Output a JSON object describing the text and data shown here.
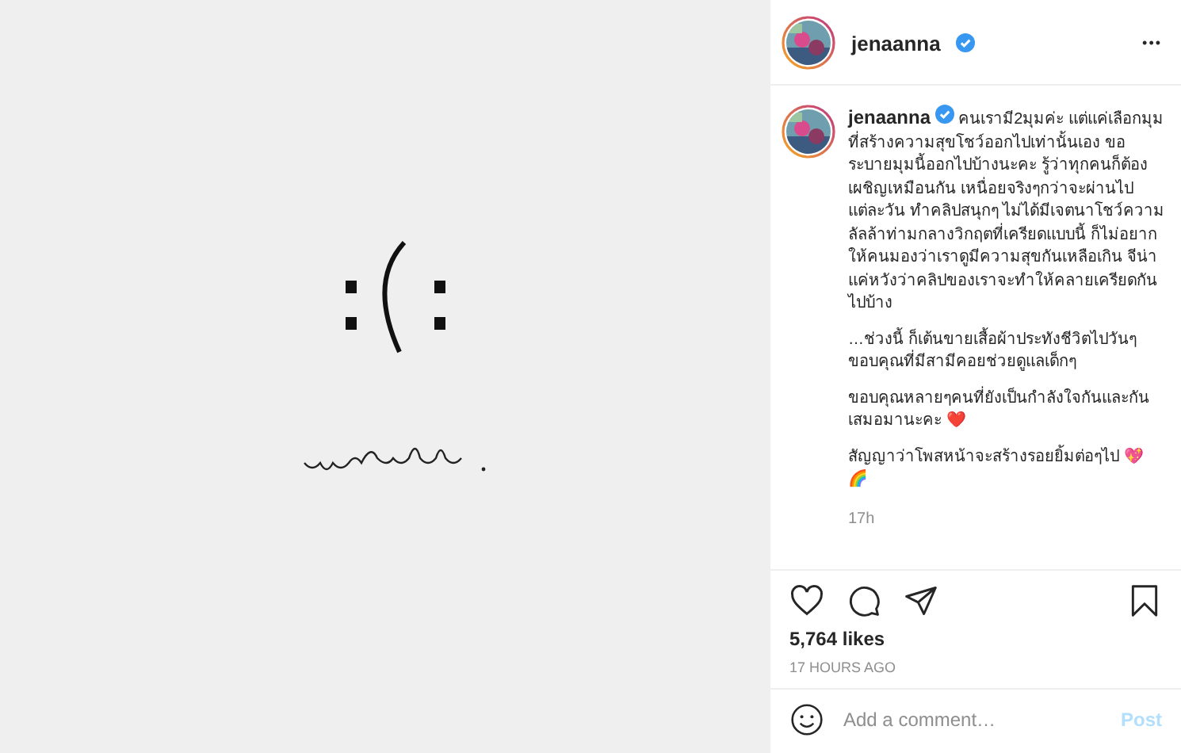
{
  "header": {
    "username": "jenaanna",
    "verified": true,
    "more": "•••"
  },
  "caption": {
    "username": "jenaanna",
    "verified": true,
    "paragraphs": [
      "คนเรามี2มุมค่ะ แต่แค่เลือกมุมที่สร้างความสุขโชว์ออกไปเท่านั้นเอง ขอระบายมุมนี้ออกไปบ้างนะคะ รู้ว่าทุกคนก็ต้องเผชิญเหมือนกัน เหนื่อยจริงๆกว่าจะผ่านไปแต่ละวัน ทำคลิปสนุกๆ ไม่ได้มีเจตนาโชว์ความลัลล้าท่ามกลางวิกฤตที่เครียดแบบนี้ ก็ไม่อยากให้คนมองว่าเราดูมีความสุขกันเหลือเกิน จีน่าแค่หวังว่าคลิปของเราจะทำให้คลายเครียดกันไปบ้าง",
      "…ช่วงนี้ ก็เต้นขายเสื้อผ้าประทังชีวิตไปวันๆ\nขอบคุณที่มีสามีคอยช่วยดูแลเด็กๆ",
      "ขอบคุณหลายๆคนที่ยังเป็นกำลังใจกันและกันเสมอมานะคะ ❤️",
      "สัญญาว่าโพสหน้าจะสร้างรอยยิ้มต่อๆไป 💖\n🌈"
    ],
    "age": "17h"
  },
  "actions": {
    "liked": false,
    "saved": false
  },
  "likes": "5,764 likes",
  "timestamp": "17 HOURS AGO",
  "comment": {
    "placeholder": "Add a comment…",
    "post": "Post"
  }
}
